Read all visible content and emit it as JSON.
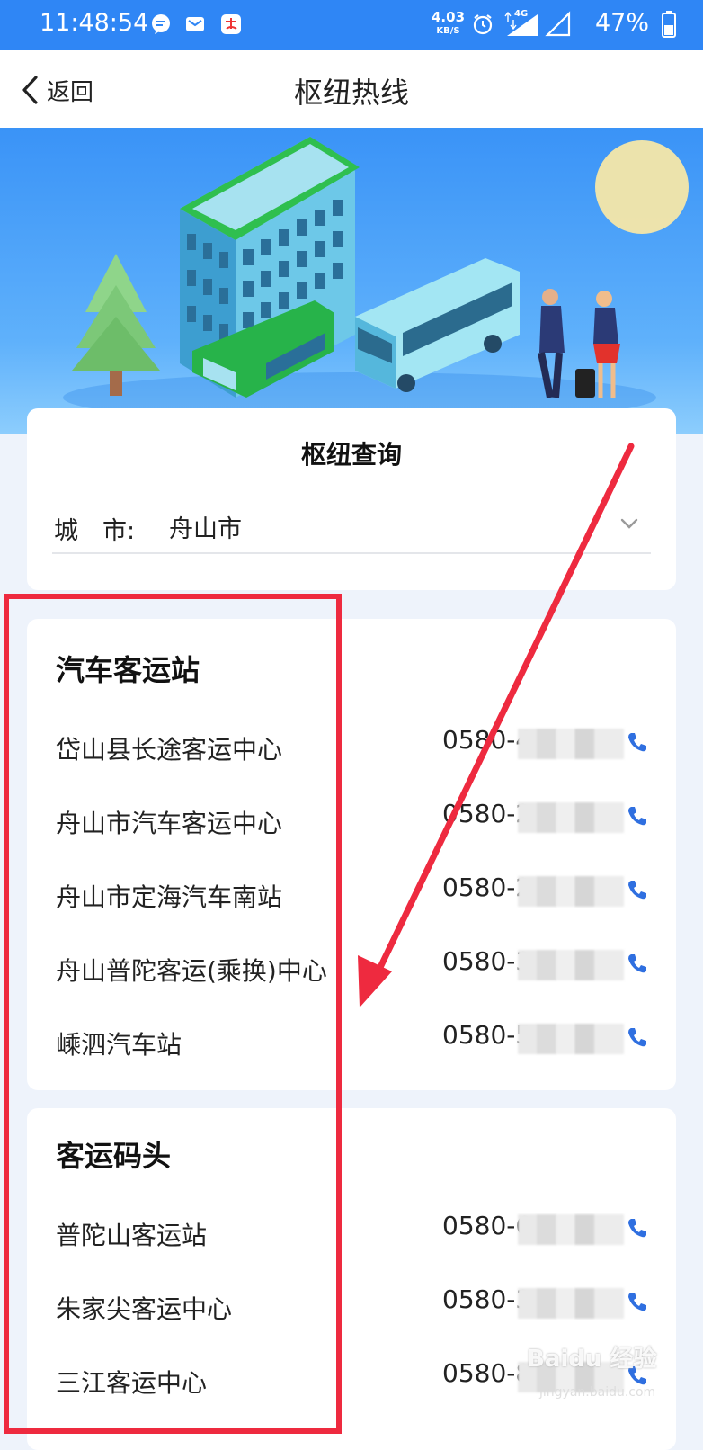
{
  "status_bar": {
    "time": "11:48:54",
    "net_speed_value": "4.03",
    "net_speed_unit": "KB/S",
    "network": "4G",
    "battery": "47%"
  },
  "header": {
    "back_label": "返回",
    "title": "枢纽热线"
  },
  "query": {
    "title": "枢纽查询",
    "city_label": "城　市:",
    "city_value": "舟山市"
  },
  "sections": {
    "buses": {
      "title": "汽车客运站",
      "items": [
        {
          "name": "岱山县长途客运中心",
          "phone": "0580-4"
        },
        {
          "name": "舟山市汽车客运中心",
          "phone": "0580-2"
        },
        {
          "name": "舟山市定海汽车南站",
          "phone": "0580-2"
        },
        {
          "name": "舟山普陀客运(乘换)中心",
          "phone": "0580-3"
        },
        {
          "name": "嵊泗汽车站",
          "phone": "0580-5"
        }
      ]
    },
    "piers": {
      "title": "客运码头",
      "items": [
        {
          "name": "普陀山客运站",
          "phone": "0580-6"
        },
        {
          "name": "朱家尖客运中心",
          "phone": "0580-3"
        },
        {
          "name": "三江客运中心",
          "phone": "0580-8"
        }
      ]
    }
  },
  "watermark": {
    "brand": "Baidu 经验",
    "sub": "jingyan.baidu.com"
  },
  "colors": {
    "status_bar": "#2f86f5",
    "accent": "#2f86f5",
    "annotation": "#ee2a3f"
  }
}
